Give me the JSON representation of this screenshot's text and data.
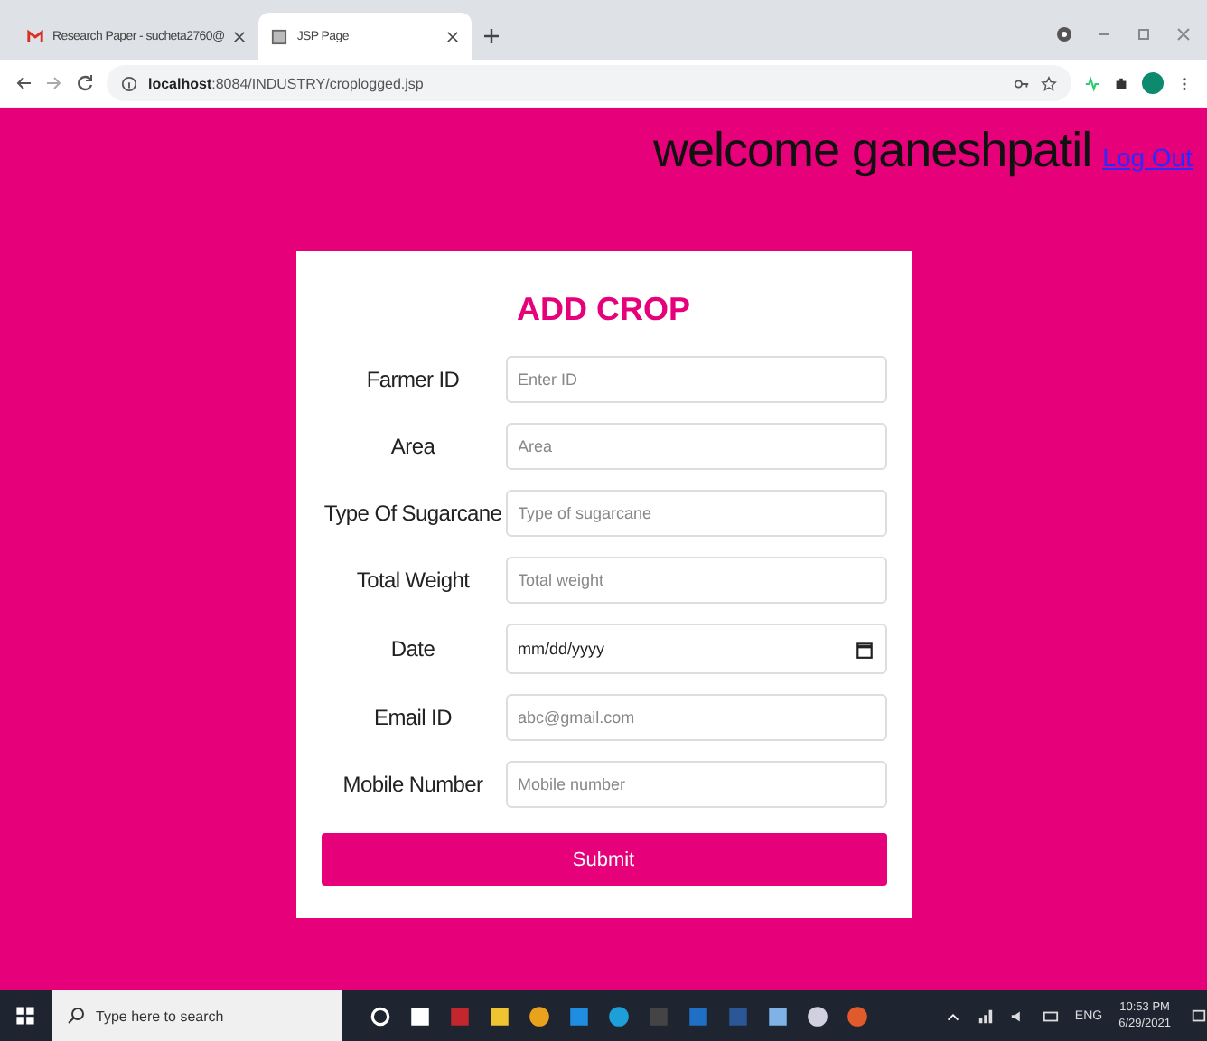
{
  "browser": {
    "tabs": [
      {
        "title": "Research Paper - sucheta2760@",
        "selected": false
      },
      {
        "title": "JSP Page",
        "selected": true
      }
    ],
    "address": {
      "host": "localhost",
      "path": ":8084/INDUSTRY/croplogged.jsp"
    }
  },
  "header": {
    "welcome": "welcome ganeshpatil",
    "logout": "Log Out"
  },
  "form": {
    "title": "ADD CROP",
    "fields": [
      {
        "label": "Farmer ID",
        "kind": "text",
        "placeholder": "Enter ID"
      },
      {
        "label": "Area",
        "kind": "text",
        "placeholder": "Area"
      },
      {
        "label": "Type Of Sugarcane",
        "kind": "text",
        "placeholder": "Type of sugarcane"
      },
      {
        "label": "Total Weight",
        "kind": "text",
        "placeholder": "Total weight"
      },
      {
        "label": "Date",
        "kind": "date",
        "placeholder": "mm/dd/yyyy"
      },
      {
        "label": "Email ID",
        "kind": "text",
        "placeholder": "abc@gmail.com"
      },
      {
        "label": "Mobile Number",
        "kind": "text",
        "placeholder": "Mobile number"
      }
    ],
    "submit": "Submit"
  },
  "taskbar": {
    "search": {
      "placeholder": "Type here to search"
    },
    "language": "ENG",
    "time": "10:53 PM",
    "date": "6/29/2021"
  }
}
